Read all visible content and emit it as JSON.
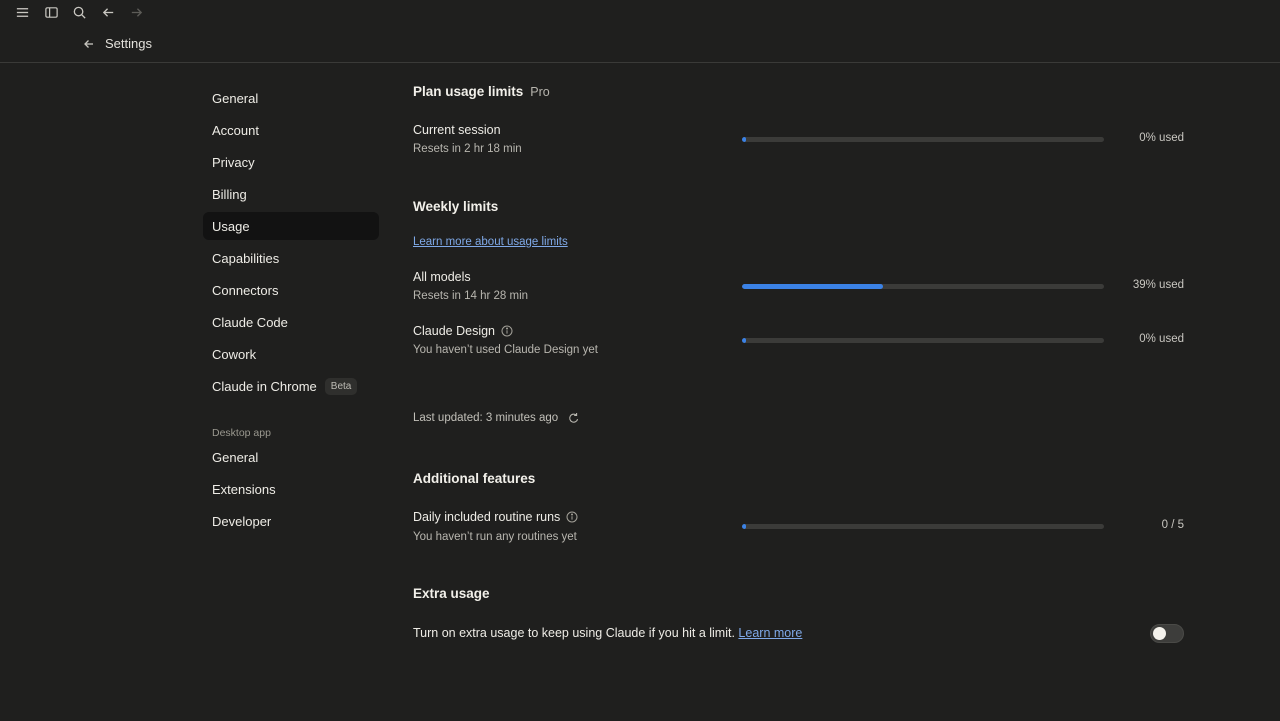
{
  "header": {
    "title": "Settings"
  },
  "sidebar": {
    "items": [
      {
        "label": "General"
      },
      {
        "label": "Account"
      },
      {
        "label": "Privacy"
      },
      {
        "label": "Billing"
      },
      {
        "label": "Usage",
        "active": true
      },
      {
        "label": "Capabilities"
      },
      {
        "label": "Connectors"
      },
      {
        "label": "Claude Code"
      },
      {
        "label": "Cowork"
      },
      {
        "label": "Claude in Chrome",
        "badge": "Beta"
      }
    ],
    "desktop_section": "Desktop app",
    "desktop_items": [
      {
        "label": "General"
      },
      {
        "label": "Extensions"
      },
      {
        "label": "Developer"
      }
    ]
  },
  "plan": {
    "title": "Plan usage limits",
    "tier": "Pro",
    "session": {
      "title": "Current session",
      "sub": "Resets in 2 hr 18 min",
      "used_fraction": 0.0,
      "pct_label": "0% used"
    }
  },
  "weekly": {
    "title": "Weekly limits",
    "link": "Learn more about usage limits",
    "all_models": {
      "title": "All models",
      "sub": "Resets in 14 hr 28 min",
      "used_fraction": 0.39,
      "pct_label": "39% used"
    },
    "design": {
      "title": "Claude Design",
      "sub": "You haven’t used Claude Design yet",
      "used_fraction": 0.0,
      "pct_label": "0% used"
    },
    "last_updated": "Last updated: 3 minutes ago"
  },
  "additional": {
    "title": "Additional features",
    "routines": {
      "title": "Daily included routine runs",
      "sub": "You haven’t run any routines yet",
      "used_fraction": 0.0,
      "count_label": "0 / 5"
    }
  },
  "extra": {
    "title": "Extra usage",
    "text": "Turn on extra usage to keep using Claude if you hit a limit.",
    "link": "Learn more",
    "enabled": false
  },
  "colors": {
    "accent": "#3b82e6",
    "background": "#1f1f1e",
    "link": "#7fa9e8"
  },
  "icons": [
    "menu-icon",
    "sidebar-toggle-icon",
    "search-icon",
    "arrow-left-icon",
    "arrow-right-icon",
    "back-arrow-icon",
    "info-icon",
    "refresh-icon"
  ]
}
